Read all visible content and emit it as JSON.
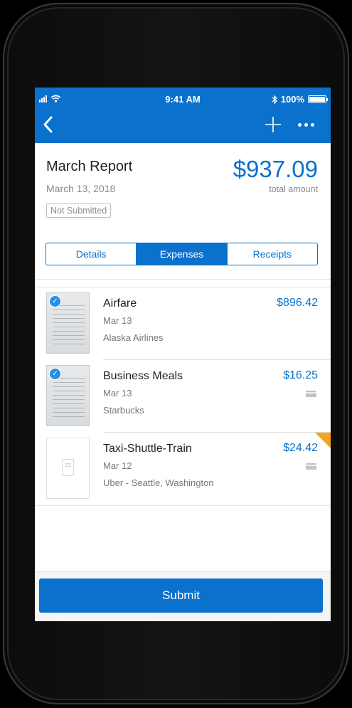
{
  "status_bar": {
    "time": "9:41 AM",
    "battery": "100%"
  },
  "nav": {
    "back_icon": "chevron-left-icon",
    "add_icon": "plus-icon",
    "more_icon": "ellipsis-icon"
  },
  "report": {
    "title": "March Report",
    "date": "March 13, 2018",
    "status": "Not Submitted",
    "total": "$937.09",
    "total_label": "total amount"
  },
  "tabs": [
    {
      "label": "Details",
      "active": false
    },
    {
      "label": "Expenses",
      "active": true
    },
    {
      "label": "Receipts",
      "active": false
    }
  ],
  "expenses": [
    {
      "title": "Airfare",
      "date": "Mar 13",
      "merchant": "Alaska Airlines",
      "amount": "$896.42",
      "has_receipt": true,
      "verified": true,
      "card": false,
      "flagged": false
    },
    {
      "title": "Business Meals",
      "date": "Mar 13",
      "merchant": "Starbucks",
      "amount": "$16.25",
      "has_receipt": true,
      "verified": true,
      "card": true,
      "flagged": false
    },
    {
      "title": "Taxi-Shuttle-Train",
      "date": "Mar 12",
      "merchant": "Uber - Seattle, Washington",
      "amount": "$24.42",
      "has_receipt": false,
      "verified": false,
      "card": true,
      "flagged": true
    }
  ],
  "submit_label": "Submit",
  "colors": {
    "accent": "#0a71cd",
    "flag": "#f3a51b"
  }
}
